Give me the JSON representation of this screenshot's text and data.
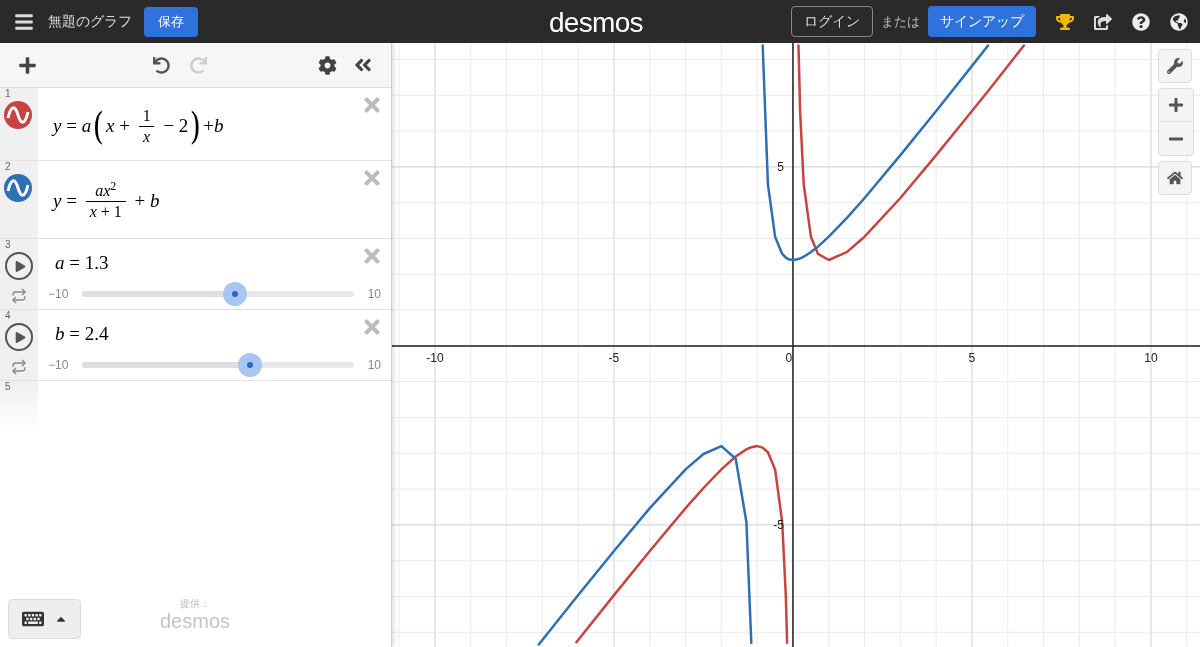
{
  "header": {
    "title": "無題のグラフ",
    "save": "保存",
    "logo": "desmos",
    "login": "ログイン",
    "or": "または",
    "signup": "サインアップ"
  },
  "expressions": [
    {
      "kind": "function",
      "number": "1",
      "color": "#c74440",
      "parts": [
        {
          "kind": "text",
          "text": "y = a"
        },
        {
          "kind": "lparen",
          "text": "("
        },
        {
          "kind": "text",
          "text": "x + "
        },
        {
          "kind": "frac",
          "num": "1",
          "den": "x"
        },
        {
          "kind": "text",
          "text": " − 2"
        },
        {
          "kind": "rparen",
          "text": ")"
        },
        {
          "kind": "text",
          "text": "+b"
        }
      ]
    },
    {
      "kind": "function",
      "number": "2",
      "color": "#2d70b3",
      "parts": [
        {
          "kind": "text",
          "text": "y = "
        },
        {
          "kind": "frac",
          "num": "ax$^{2}$",
          "den": "x + 1"
        },
        {
          "kind": "text",
          "text": " + b"
        }
      ]
    },
    {
      "kind": "slider",
      "number": "3",
      "label": "a = 1.3",
      "min": "−10",
      "max": "10",
      "level": 0.565
    },
    {
      "kind": "slider",
      "number": "4",
      "label": "b = 2.4",
      "min": "−10",
      "max": "10",
      "level": 0.62
    },
    {
      "kind": "empty",
      "number": "5"
    }
  ],
  "footer": {
    "credit": "提供：",
    "brand": "desmos"
  },
  "graph": {
    "chart_data": {
      "type": "line",
      "grid": true,
      "xlim": [
        -11.2,
        11.37
      ],
      "ylim": [
        -8.41,
        8.46
      ],
      "xticks": [
        -10,
        -5,
        0,
        5,
        10
      ],
      "yticks": [
        -5,
        5
      ],
      "x": [
        -7.1,
        -6.05,
        -5,
        -4,
        -3,
        -2.5,
        -2,
        -1.6,
        -1.3,
        -1.165,
        -1,
        -0.845,
        -0.7,
        -0.5,
        -0.3,
        -0.2,
        -0.165,
        -0.1,
        0,
        0.1,
        0.155,
        0.2,
        0.3,
        0.5,
        0.7,
        1,
        1.5,
        2,
        3,
        4,
        5,
        5.45,
        6,
        6.45
      ],
      "series": [
        {
          "color": "#c74440",
          "values": [
            null,
            -8.28,
            -6.96,
            -5.73,
            -4.53,
            -3.97,
            -3.45,
            -3.09,
            -2.89,
            -2.83,
            -2.8,
            -2.84,
            -2.97,
            -3.45,
            -4.92,
            -6.96,
            -8.29,
            null,
            null,
            null,
            8.39,
            6.56,
            4.52,
            3.05,
            2.57,
            2.4,
            2.62,
            3.05,
            4.13,
            5.33,
            6.56,
            7.12,
            7.82,
            8.39
          ]
        },
        {
          "color": "#2d70b3",
          "values": [
            -8.34,
            -7.02,
            -5.73,
            -4.53,
            -3.45,
            -3.02,
            -2.8,
            -3.15,
            -4.92,
            -8.29,
            null,
            8.39,
            4.52,
            3.05,
            2.57,
            2.47,
            2.44,
            2.41,
            2.4,
            2.41,
            2.43,
            2.44,
            2.49,
            2.62,
            2.77,
            3.05,
            3.57,
            4.13,
            5.33,
            6.56,
            7.82,
            8.39,
            null,
            null
          ]
        }
      ]
    }
  }
}
